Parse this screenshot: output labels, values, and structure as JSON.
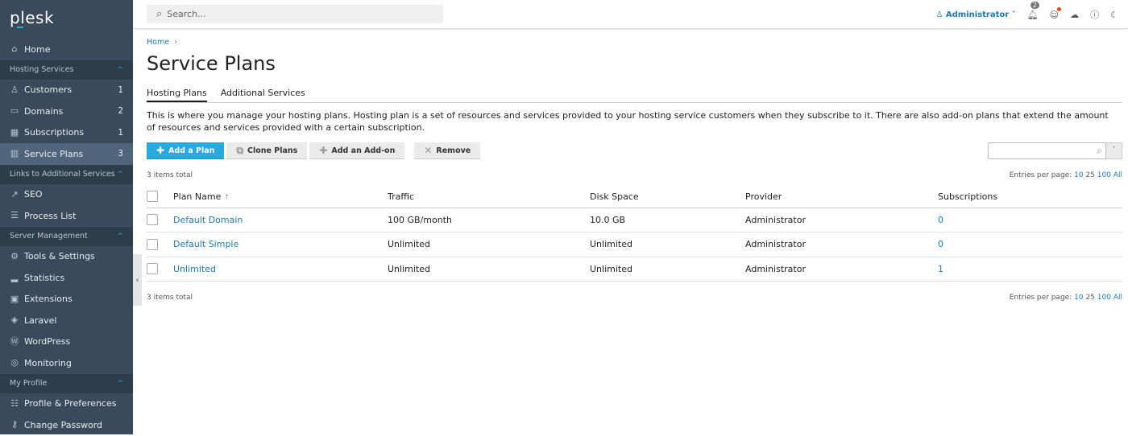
{
  "sidebar": {
    "logo": "plesk",
    "items": [
      {
        "type": "item",
        "label": "Home",
        "icon": "home-icon",
        "glyph": "⌂"
      },
      {
        "type": "section",
        "label": "Hosting Services"
      },
      {
        "type": "item",
        "label": "Customers",
        "icon": "user-icon",
        "glyph": "♙",
        "count": "1"
      },
      {
        "type": "item",
        "label": "Domains",
        "icon": "monitor-icon",
        "glyph": "▭",
        "count": "2"
      },
      {
        "type": "item",
        "label": "Subscriptions",
        "icon": "grid-icon",
        "glyph": "▦",
        "count": "1"
      },
      {
        "type": "item",
        "label": "Service Plans",
        "icon": "book-icon",
        "glyph": "▥",
        "count": "3",
        "active": true
      },
      {
        "type": "section",
        "label": "Links to Additional Services"
      },
      {
        "type": "item",
        "label": "SEO",
        "icon": "chart-up-icon",
        "glyph": "↗"
      },
      {
        "type": "item",
        "label": "Process List",
        "icon": "list-icon",
        "glyph": "☰"
      },
      {
        "type": "section",
        "label": "Server Management"
      },
      {
        "type": "item",
        "label": "Tools & Settings",
        "icon": "sliders-icon",
        "glyph": "⚙"
      },
      {
        "type": "item",
        "label": "Statistics",
        "icon": "bar-chart-icon",
        "glyph": "▂"
      },
      {
        "type": "item",
        "label": "Extensions",
        "icon": "extensions-icon",
        "glyph": "▣"
      },
      {
        "type": "item",
        "label": "Laravel",
        "icon": "laravel-icon",
        "glyph": "◈"
      },
      {
        "type": "item",
        "label": "WordPress",
        "icon": "wordpress-icon",
        "glyph": "Ⓦ"
      },
      {
        "type": "item",
        "label": "Monitoring",
        "icon": "monitoring-icon",
        "glyph": "◎"
      },
      {
        "type": "section",
        "label": "My Profile"
      },
      {
        "type": "item",
        "label": "Profile & Preferences",
        "icon": "profile-icon",
        "glyph": "☷"
      },
      {
        "type": "item",
        "label": "Change Password",
        "icon": "key-icon",
        "glyph": "⚷"
      }
    ]
  },
  "header": {
    "search_placeholder": "Search...",
    "user": "Administrator",
    "notifications_count": "2"
  },
  "breadcrumb": [
    "Home"
  ],
  "page_title": "Service Plans",
  "tabs": [
    {
      "label": "Hosting Plans",
      "active": true
    },
    {
      "label": "Additional Services"
    }
  ],
  "description": "This is where you manage your hosting plans. Hosting plan is a set of resources and services provided to your hosting service customers when they subscribe to it. There are also add-on plans that extend the amount of resources and services provided with a certain subscription.",
  "toolbar": {
    "add_plan": "Add a Plan",
    "clone_plans": "Clone Plans",
    "add_addon": "Add an Add-on",
    "remove": "Remove"
  },
  "list": {
    "total": "3 items total",
    "entries_label": "Entries per page:",
    "entries_options": [
      "10",
      "25",
      "100",
      "All"
    ],
    "entries_current": "25",
    "columns": [
      "Plan Name",
      "Traffic",
      "Disk Space",
      "Provider",
      "Subscriptions"
    ],
    "rows": [
      {
        "name": "Default Domain",
        "traffic": "100 GB/month",
        "disk": "10.0 GB",
        "provider": "Administrator",
        "subs": "0"
      },
      {
        "name": "Default Simple",
        "traffic": "Unlimited",
        "disk": "Unlimited",
        "provider": "Administrator",
        "subs": "0"
      },
      {
        "name": "Unlimited",
        "traffic": "Unlimited",
        "disk": "Unlimited",
        "provider": "Administrator",
        "subs": "1"
      }
    ]
  },
  "colors": {
    "accent": "#28aade",
    "link": "#1c7ab3",
    "sidebar": "#3b4a5a"
  }
}
